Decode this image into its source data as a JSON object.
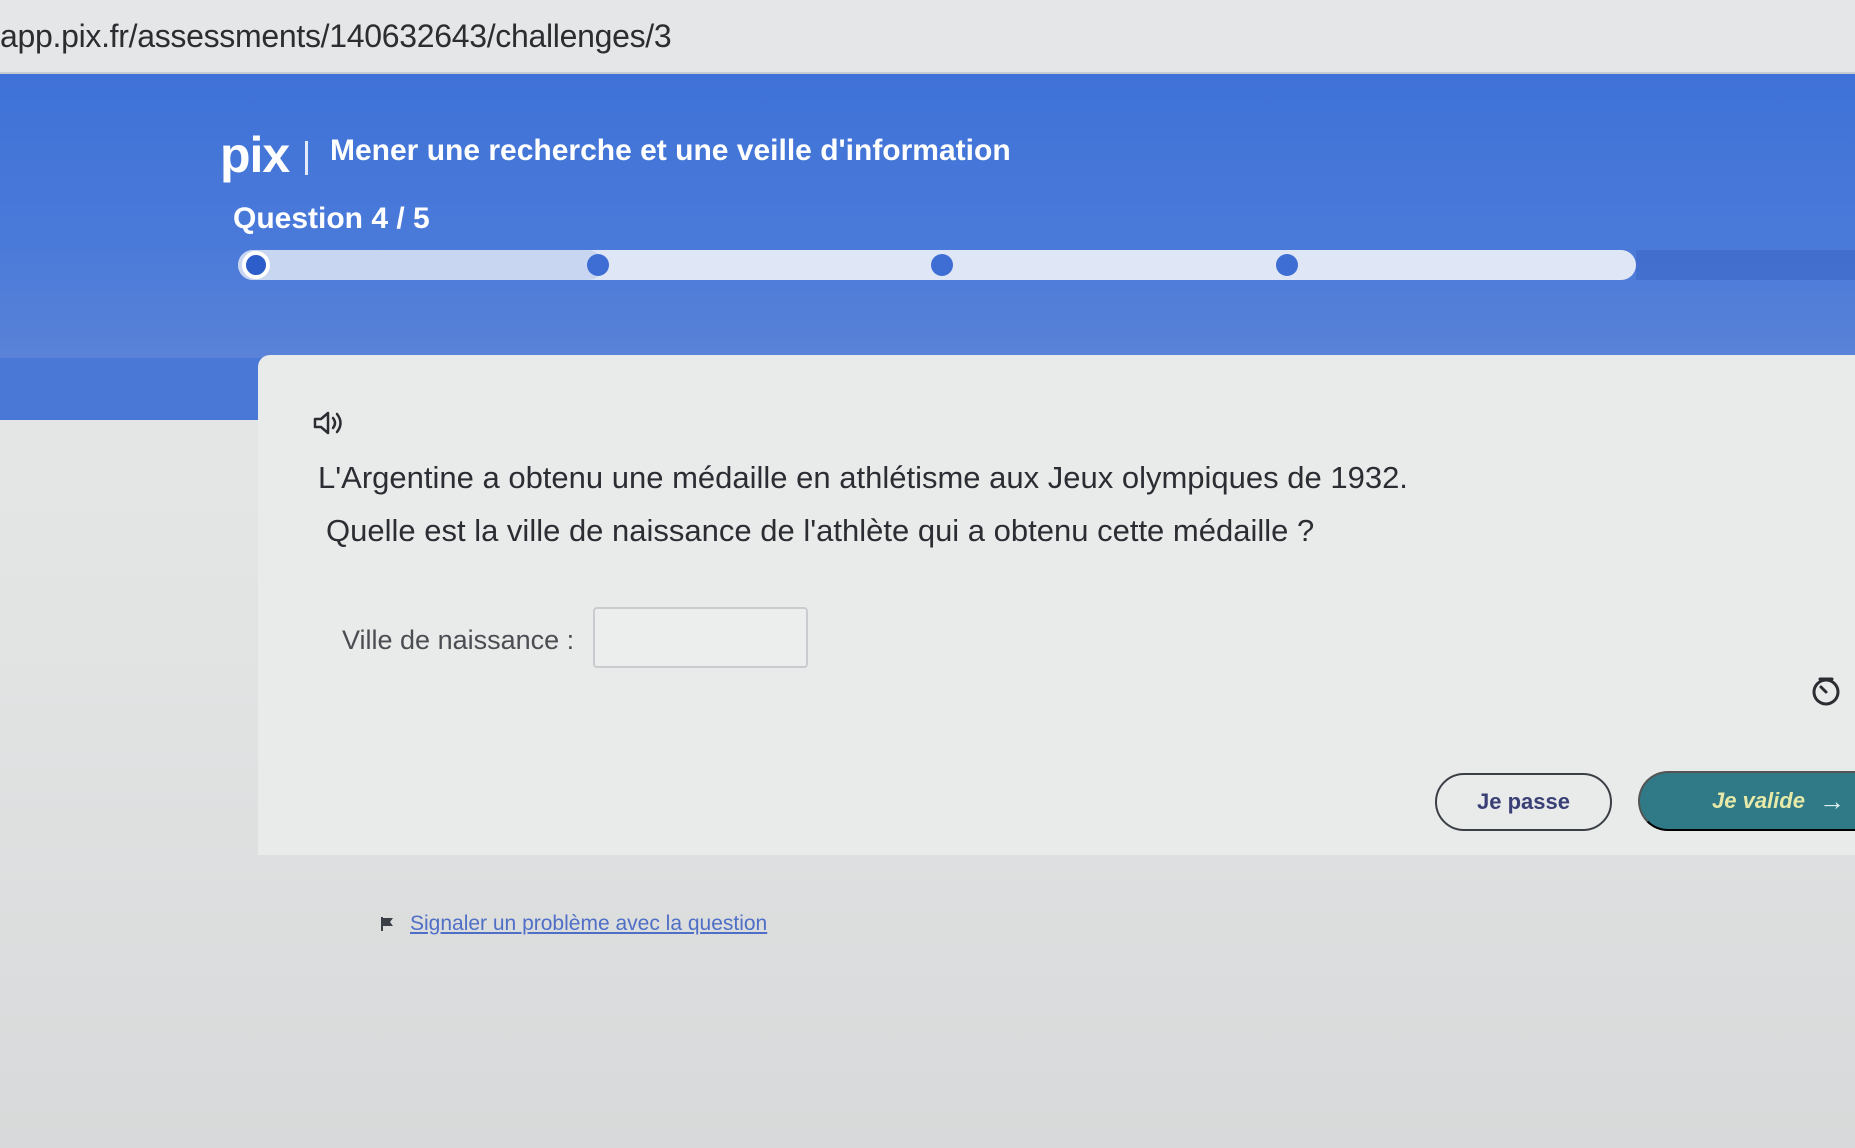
{
  "browser": {
    "url": "app.pix.fr/assessments/140632643/challenges/3"
  },
  "header": {
    "logo": "pix",
    "competence": "Mener une recherche et une veille d'information",
    "question_counter": "Question 4 / 5",
    "progress": {
      "current": 4,
      "total": 5
    }
  },
  "challenge": {
    "prompt_line1": "L'Argentine a obtenu une médaille en athlétisme aux Jeux olympiques de 1932.",
    "prompt_line2": "Quelle est la ville de naissance de l'athlète qui a obtenu cette médaille ?",
    "field_label": "Ville de naissance :",
    "field_value": ""
  },
  "actions": {
    "skip_label": "Je passe",
    "validate_label": "Je valide"
  },
  "report": {
    "label": "Signaler un problème avec la question"
  },
  "colors": {
    "header_blue": "#3f72d8",
    "validate_teal": "#2f7a86",
    "link_blue": "#4f6ec6"
  }
}
